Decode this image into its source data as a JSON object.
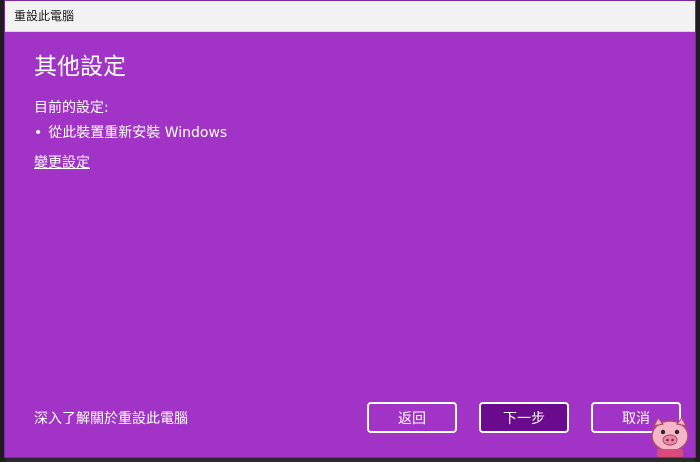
{
  "window": {
    "title": "重設此電腦"
  },
  "page": {
    "heading": "其他設定",
    "current_settings_label": "目前的設定:",
    "settings_items": [
      "從此裝置重新安裝 Windows"
    ],
    "change_settings_link": "變更設定",
    "learn_more_link": "深入了解關於重設此電腦"
  },
  "buttons": {
    "back": "返回",
    "next": "下一步",
    "cancel": "取消"
  },
  "colors": {
    "background": "#a133c6",
    "titlebar": "#f2f2f2",
    "primary_button": "#6a0a8d",
    "text": "#ffffff"
  },
  "icons": {
    "bullet": "•",
    "watermark": "pig-mascot-icon"
  }
}
